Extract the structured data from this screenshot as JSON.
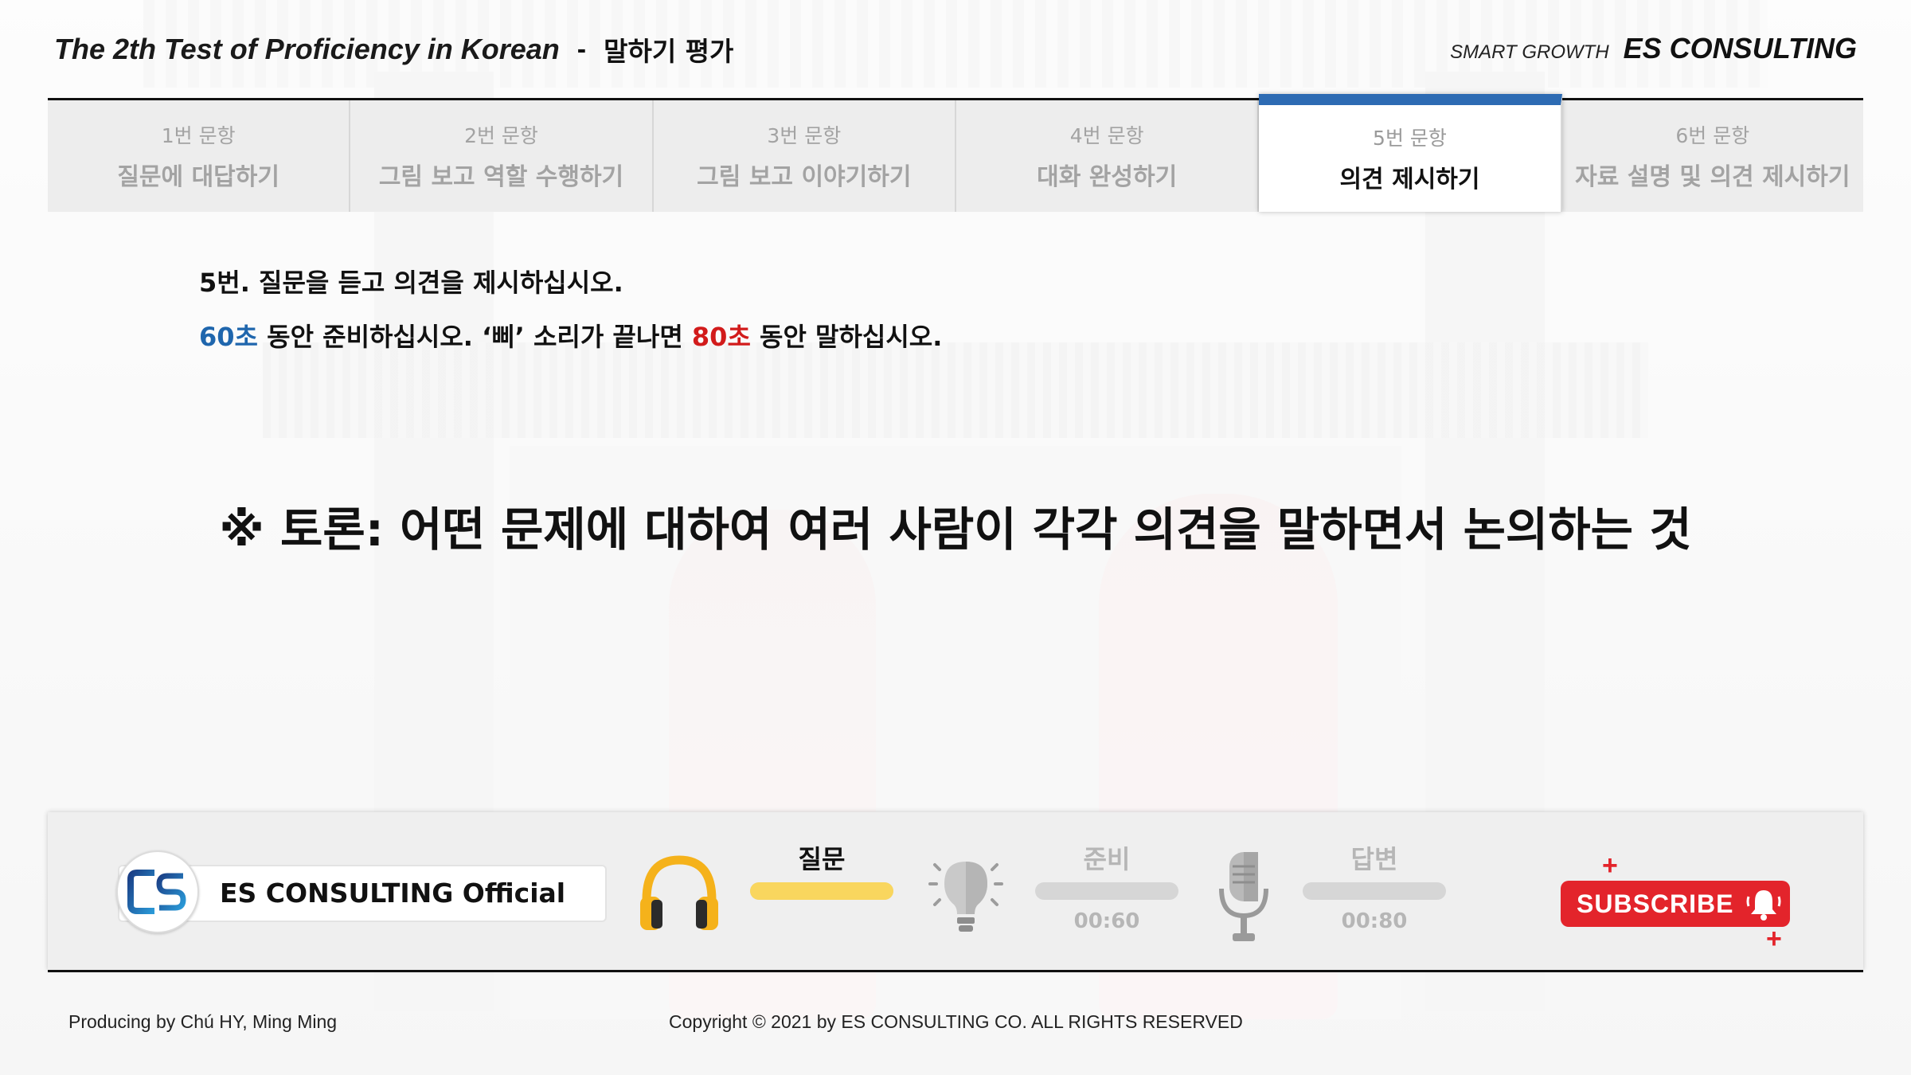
{
  "header": {
    "title_en": "The 2th Test of Proficiency in Korean",
    "separator": "-",
    "title_ko": "말하기 평가",
    "tagline": "SMART GROWTH",
    "brand": "ES CONSULTING"
  },
  "tabs": [
    {
      "num": "1번 문항",
      "title": "질문에 대답하기",
      "active": false
    },
    {
      "num": "2번 문항",
      "title": "그림 보고 역할 수행하기",
      "active": false
    },
    {
      "num": "3번 문항",
      "title": "그림 보고 이야기하기",
      "active": false
    },
    {
      "num": "4번 문항",
      "title": "대화 완성하기",
      "active": false
    },
    {
      "num": "5번 문항",
      "title": "의견 제시하기",
      "active": true
    },
    {
      "num": "6번 문항",
      "title": "자료 설명 및 의견 제시하기",
      "active": false
    }
  ],
  "instruction": {
    "line1": "5번. 질문을 듣고 의견을 제시하십시오.",
    "prep_time": "60초",
    "mid_text": " 동안 준비하십시오. ‘삐’ 소리가 끝나면 ",
    "answer_time": "80초",
    "end_text": " 동안 말하십시오."
  },
  "definition": "※ 토론: 어떤 문제에 대하여 여러 사람이 각각 의견을 말하면서 논의하는 것",
  "controls": {
    "channel_name": "ES CONSULTING Official",
    "question": {
      "label": "질문",
      "progress": 1.0,
      "color": "#f9d65e"
    },
    "prepare": {
      "label": "준비",
      "time": "00:60",
      "progress": 0.0
    },
    "answer": {
      "label": "답변",
      "time": "00:80",
      "progress": 0.0
    },
    "subscribe_label": "SUBSCRIBE",
    "plus": "+",
    "icons": [
      "headphones-icon",
      "lightbulb-icon",
      "microphone-icon",
      "bell-icon"
    ]
  },
  "colors": {
    "active_tab_accent": "#2d6bb3",
    "prep_time": "#1f66ad",
    "answer_time": "#d21b1b",
    "subscribe": "#e3242b"
  },
  "footer": {
    "producer": "Producing by Chú HY, Ming Ming",
    "copyright": "Copyright © 2021 by ES CONSULTING CO. ALL RIGHTS RESERVED"
  }
}
